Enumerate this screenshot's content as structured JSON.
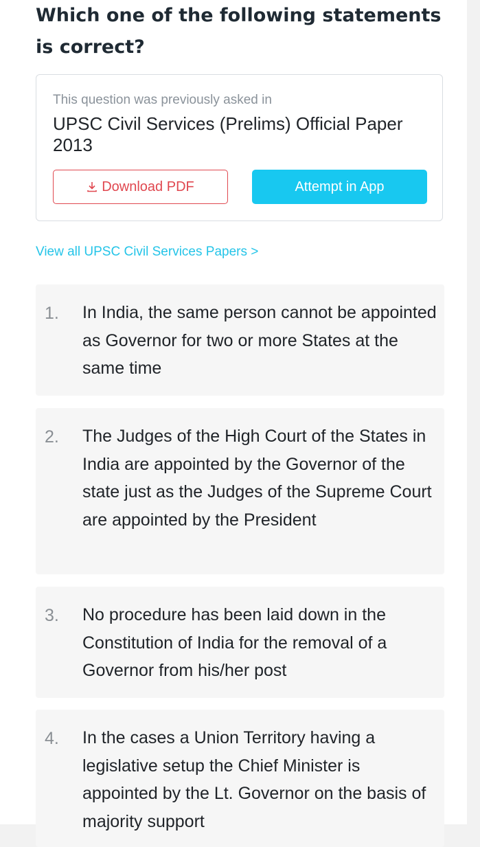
{
  "question": {
    "title": "Which one of the following statements is correct?"
  },
  "source": {
    "caption": "This question was previously asked in",
    "paper": "UPSC Civil Services (Prelims) Official Paper 2013",
    "download_label": "Download PDF",
    "download_icon": "download-icon",
    "attempt_label": "Attempt in App"
  },
  "view_all_link": "View all UPSC Civil Services Papers >",
  "options": [
    {
      "num": "1.",
      "text": "In India, the same person cannot be appointed as Governor for two or more States at the same time"
    },
    {
      "num": "2.",
      "text": "The Judges of the High Court of the States in India are appointed by the Governor of the state just as the Judges of the Supreme Court are appointed by the President"
    },
    {
      "num": "3.",
      "text": "No procedure has been laid down in the Constitution of India for the removal of a Governor from his/her post"
    },
    {
      "num": "4.",
      "text": "In the cases a Union Territory having a legislative setup the Chief Minister is appointed by the Lt. Governor on the basis of majority support"
    }
  ],
  "colors": {
    "accent": "#18c8f0",
    "link": "#24c4e8",
    "danger": "#e0474f"
  }
}
